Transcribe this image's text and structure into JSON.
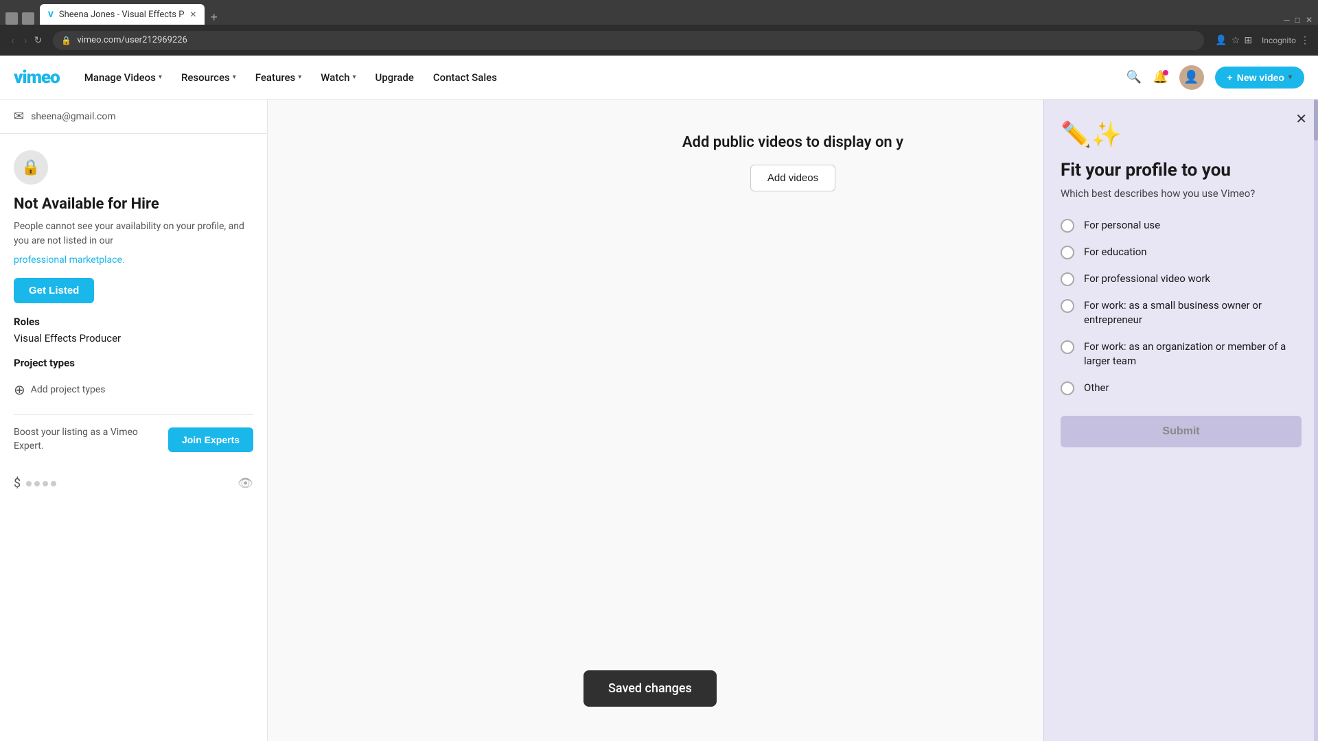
{
  "browser": {
    "url": "vimeo.com/user212969226",
    "tab_title": "Sheena Jones - Visual Effects P",
    "tab_favicon": "V"
  },
  "nav": {
    "logo": "vimeo",
    "items": [
      {
        "label": "Manage Videos",
        "has_dropdown": true
      },
      {
        "label": "Resources",
        "has_dropdown": true
      },
      {
        "label": "Features",
        "has_dropdown": true
      },
      {
        "label": "Watch",
        "has_dropdown": true
      },
      {
        "label": "Upgrade",
        "has_dropdown": false
      },
      {
        "label": "Contact Sales",
        "has_dropdown": false
      }
    ],
    "new_video_label": "New video"
  },
  "left_panel": {
    "email": "sheena@gmail.com",
    "hire_section": {
      "title": "Not Available for Hire",
      "description": "People cannot see your availability on your profile, and you are not listed in our",
      "marketplace_link": "professional marketplace.",
      "get_listed_label": "Get Listed",
      "roles_label": "Roles",
      "roles_value": "Visual Effects Producer",
      "project_types_label": "Project types",
      "add_project_types_label": "Add project types"
    },
    "boost_section": {
      "text": "Boost your listing as a Vimeo Expert.",
      "join_experts_label": "Join Experts"
    }
  },
  "main_content": {
    "add_videos_text": "Add public videos to display on y",
    "add_videos_btn_label": "Add videos"
  },
  "toast": {
    "message": "Saved changes"
  },
  "overlay": {
    "title": "Fit your profile to you",
    "subtitle": "Which best describes how you use Vimeo?",
    "options": [
      {
        "label": "For personal use"
      },
      {
        "label": "For education"
      },
      {
        "label": "For professional video work"
      },
      {
        "label": "For work: as a small business owner or entrepreneur"
      },
      {
        "label": "For work: as an organization or member of a larger team"
      },
      {
        "label": "Other"
      }
    ],
    "submit_label": "Submit"
  }
}
